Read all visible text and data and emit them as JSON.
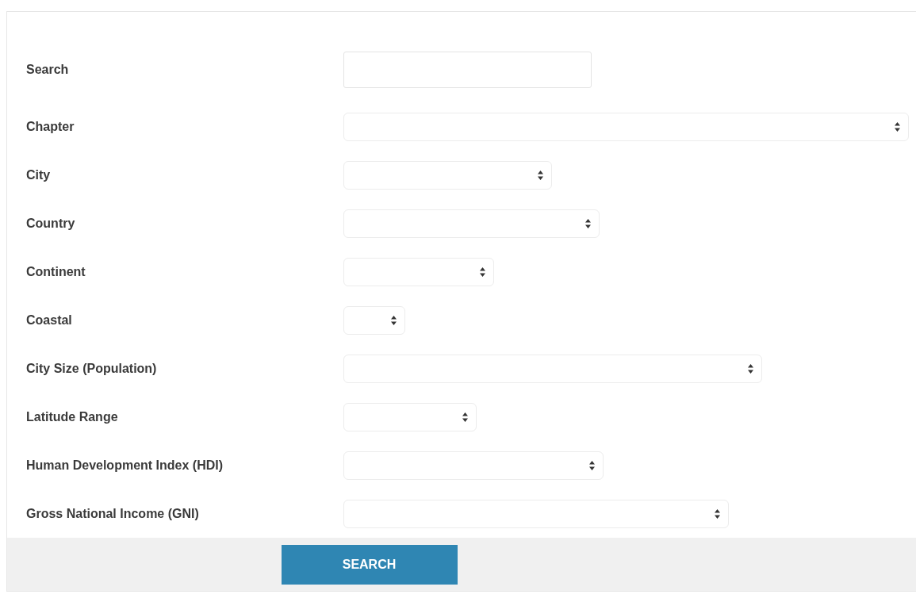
{
  "fields": [
    {
      "label": "Search",
      "kind": "text"
    },
    {
      "label": "Chapter",
      "kind": "select"
    },
    {
      "label": "City",
      "kind": "select"
    },
    {
      "label": "Country",
      "kind": "select"
    },
    {
      "label": "Continent",
      "kind": "select"
    },
    {
      "label": "Coastal",
      "kind": "select"
    },
    {
      "label": "City Size (Population)",
      "kind": "select"
    },
    {
      "label": "Latitude Range",
      "kind": "select"
    },
    {
      "label": "Human Development Index (HDI)",
      "kind": "select"
    },
    {
      "label": "Gross National Income (GNI)",
      "kind": "select"
    }
  ],
  "submit": {
    "label": "SEARCH"
  }
}
